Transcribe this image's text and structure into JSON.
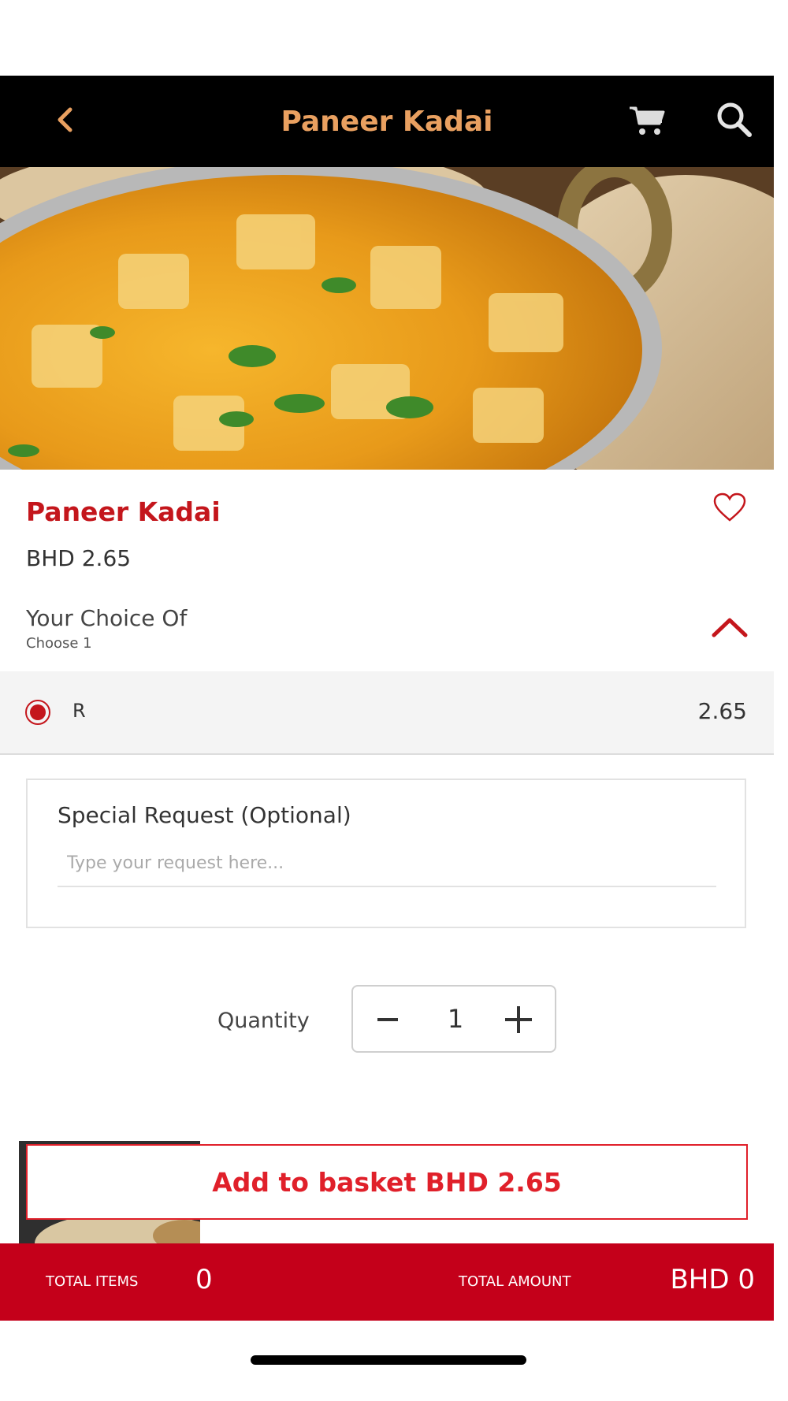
{
  "header": {
    "title": "Paneer Kadai",
    "back_icon": "chevron-left-icon",
    "cart_icon": "cart-icon",
    "search_icon": "search-icon",
    "title_color": "#e9a060",
    "background": "#000000"
  },
  "product": {
    "name": "Paneer Kadai",
    "price": "BHD 2.65",
    "favorite_icon": "heart-icon",
    "name_color": "#c4161c"
  },
  "choice": {
    "title": "Your Choice Of",
    "subtitle": "Choose 1",
    "options": [
      {
        "label": "R",
        "price": "2.65",
        "selected": true
      }
    ]
  },
  "special_request": {
    "title": "Special Request (Optional)",
    "placeholder": "Type your request here...",
    "value": ""
  },
  "quantity": {
    "label": "Quantity",
    "value": "1"
  },
  "add_to_basket": {
    "label": "Add to basket BHD 2.65",
    "color": "#e0202a"
  },
  "footer": {
    "total_items_label": "TOTAL ITEMS",
    "total_items_value": "0",
    "total_amount_label": "TOTAL AMOUNT",
    "total_amount_value": "BHD 0",
    "background": "#c4001a"
  }
}
